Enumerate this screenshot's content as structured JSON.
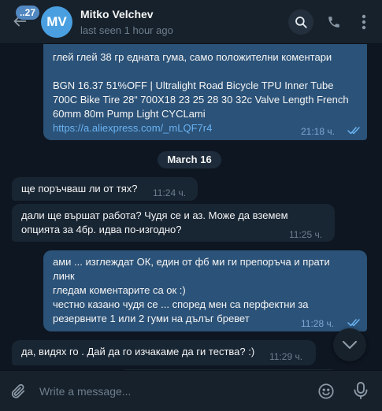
{
  "header": {
    "unread_count": "..27",
    "avatar_initials": "MV",
    "contact_name": "Mitko Velchev",
    "status": "last seen 1 hour ago"
  },
  "messages": [
    {
      "direction": "out",
      "lines": [
        "глей глей 38 гр едната гума, само положителни коментари",
        "",
        "BGN 16.37  51%OFF | Ultralight Road Bicycle TPU Inner Tube",
        "700C Bike Tire 28“ 700X18 23 25 28 30 32c Valve Length French",
        "60mm 80m Pump Light CYCLami"
      ],
      "link": "https://a.aliexpress.com/_mLQF7r4",
      "time": "21:18 ч.",
      "read": true
    },
    {
      "direction": "in",
      "lines": [
        "ще поръчваш ли от тях?"
      ],
      "time": "11:24 ч."
    },
    {
      "direction": "in",
      "lines": [
        "дали ще вършат работа? Чудя се и аз. Може да вземем",
        "опцията за 4бр. идва по-изгодно?"
      ],
      "time": "11:25 ч."
    },
    {
      "direction": "out",
      "lines": [
        "ами ... изглеждат ОК, един от фб ми ги препоръча и прати",
        "линк",
        "гледам коментарите са ок :)",
        "честно казано чудя се ... според мен са перфектни за",
        "резервните 1 или 2 гуми на дълъг бревет"
      ],
      "time": "11:28 ч.",
      "read": true
    },
    {
      "direction": "in",
      "lines": [
        "да, видях го . Дай да го изчакаме да ги тества? :)"
      ],
      "time": "11:29 ч."
    }
  ],
  "date_separator": "March 16",
  "composer": {
    "placeholder": "Write a message..."
  },
  "icons": {
    "back": "arrow-left-icon",
    "search": "search-icon",
    "call": "phone-icon",
    "menu": "more-vertical-icon",
    "scroll": "chevron-down-icon",
    "attach": "paperclip-icon",
    "emoji": "emoji-icon",
    "mic": "microphone-icon"
  },
  "colors": {
    "background": "#0e1621",
    "panel": "#17212b",
    "outgoing_bubble": "#2b5278",
    "incoming_bubble": "#182533",
    "accent": "#5288c1",
    "link": "#6ab3f3",
    "read_ticks": "#6ab3f3"
  }
}
